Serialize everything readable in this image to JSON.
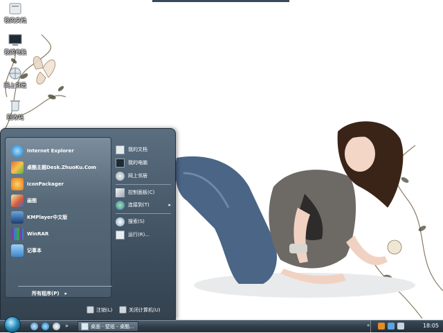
{
  "desktop": {
    "icons": [
      {
        "label": "我的文档",
        "icon": "folder-icon"
      },
      {
        "label": "我的电脑",
        "icon": "computer-icon"
      },
      {
        "label": "网上邻居",
        "icon": "network-icon"
      },
      {
        "label": "回收站",
        "icon": "recycle-bin-icon"
      }
    ]
  },
  "start_menu": {
    "programs": [
      {
        "label": "Internet Explorer",
        "icon": "internet-explorer-icon"
      },
      {
        "label": "桌酷主题Desk.ZhuoKu.Com",
        "icon": "theme-icon"
      },
      {
        "label": "IconPackager",
        "icon": "iconpackager-icon"
      },
      {
        "label": "画图",
        "icon": "paint-icon"
      },
      {
        "label": "KMPlayer中文版",
        "icon": "kmplayer-icon"
      },
      {
        "label": "WinRAR",
        "icon": "winrar-icon"
      },
      {
        "label": "记事本",
        "icon": "notepad-icon"
      }
    ],
    "all_programs": "所有程序(P)",
    "places": [
      {
        "label": "我的文档",
        "icon": "documents-icon"
      },
      {
        "label": "我的电脑",
        "icon": "computer-icon"
      },
      {
        "label": "网上邻居",
        "icon": "network-icon"
      },
      {
        "label": "控制面板(C)",
        "icon": "control-panel-icon"
      },
      {
        "label": "连接到(T)",
        "icon": "connect-icon"
      },
      {
        "label": "搜索(S)",
        "icon": "search-icon"
      },
      {
        "label": "运行(R)...",
        "icon": "run-icon"
      }
    ],
    "logoff": "注销(L)",
    "shutdown": "关闭计算机(U)"
  },
  "taskbar": {
    "task_label": "桌面 - 壁纸 - 桌酷...",
    "clock": "18:05"
  }
}
